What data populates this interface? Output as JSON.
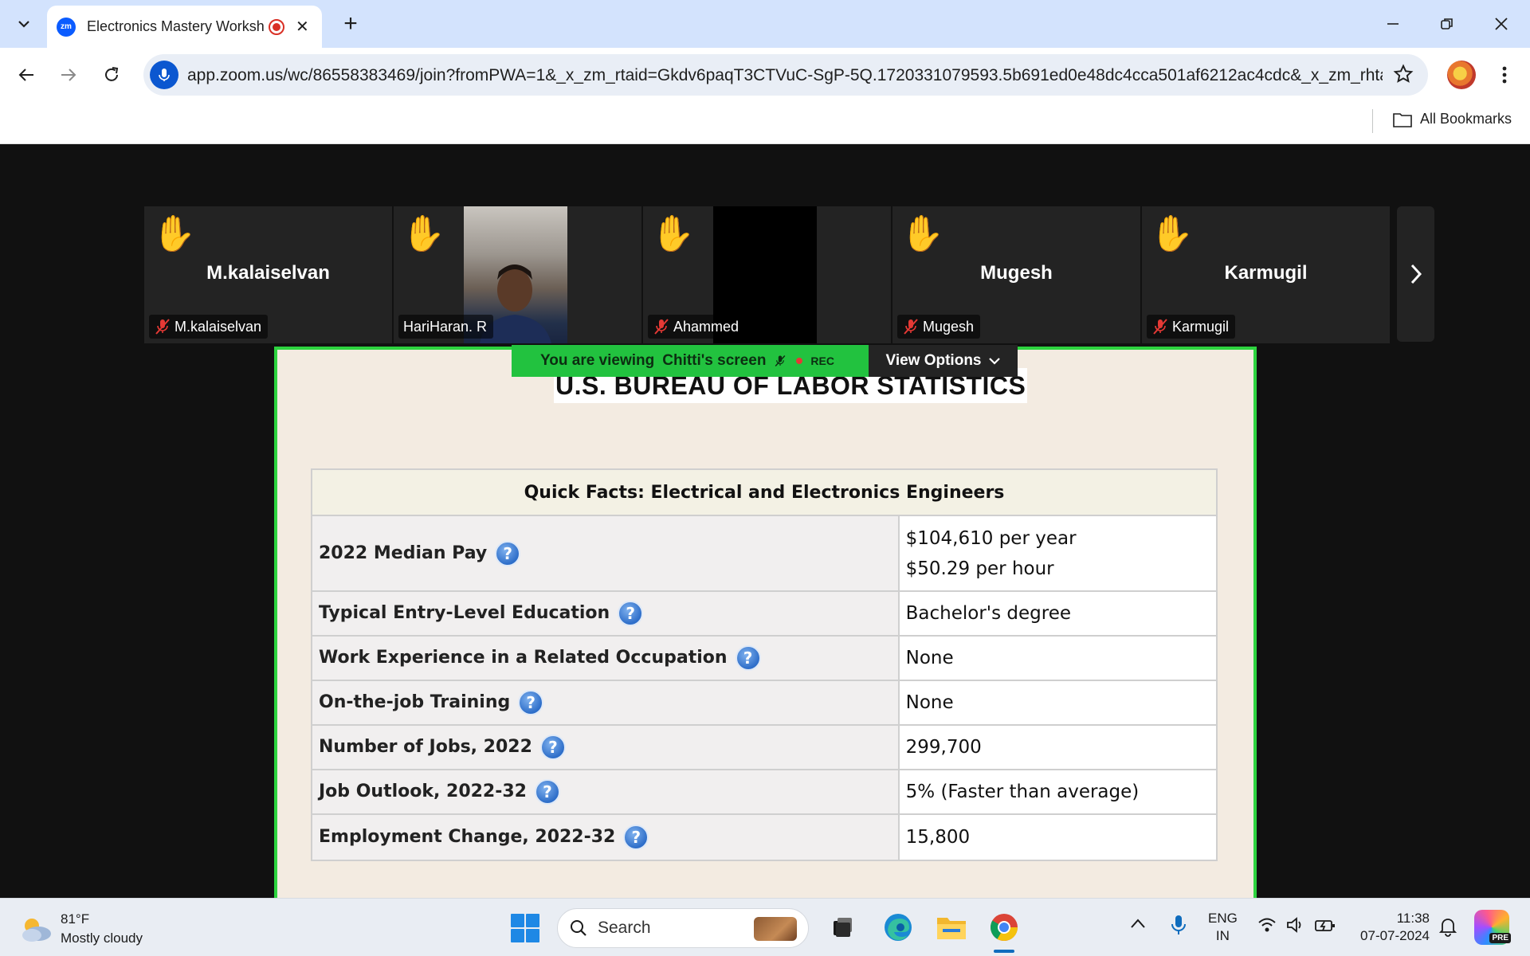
{
  "browser": {
    "tab_title": "Electronics Mastery Worksh",
    "tab_favicon": "zm",
    "url": "app.zoom.us/wc/86558383469/join?fromPWA=1&_x_zm_rtaid=Gkdv6paqT3CTVuC-SgP-5Q.1720331079593.5b691ed0e48dc4cca501af6212ac4cdc&_x_zm_rhtaid...",
    "bookmarks_label": "All Bookmarks"
  },
  "meeting": {
    "participants": [
      {
        "display": "M.kalaiselvan",
        "tag": "M.kalaiselvan",
        "muted": true,
        "video": false
      },
      {
        "display": "",
        "tag": "HariHaran. R",
        "muted": false,
        "video": true
      },
      {
        "display": "",
        "tag": "Ahammed",
        "muted": true,
        "video": true
      },
      {
        "display": "Mugesh",
        "tag": "Mugesh",
        "muted": true,
        "video": false
      },
      {
        "display": "Karmugil",
        "tag": "Karmugil",
        "muted": true,
        "video": false
      }
    ],
    "banner": {
      "prefix": "You are viewing",
      "screen_owner": "Chitti's screen",
      "rec": "REC"
    },
    "view_options": "View Options"
  },
  "slide": {
    "title": "U.S. BUREAU OF LABOR STATISTICS",
    "table_header": "Quick Facts: Electrical and Electronics Engineers",
    "rows": [
      {
        "label": "2022 Median Pay",
        "value": "$104,610 per year",
        "value2": "$50.29 per hour"
      },
      {
        "label": "Typical Entry-Level Education",
        "value": "Bachelor's degree"
      },
      {
        "label": "Work Experience in a Related Occupation",
        "value": "None"
      },
      {
        "label": "On-the-job Training",
        "value": "None"
      },
      {
        "label": "Number of Jobs, 2022",
        "value": "299,700"
      },
      {
        "label": "Job Outlook, 2022-32",
        "value": "5% (Faster than average)"
      },
      {
        "label": "Employment Change, 2022-32",
        "value": "15,800"
      }
    ],
    "help_glyph": "?"
  },
  "taskbar": {
    "weather_temp": "81°F",
    "weather_desc": "Mostly cloudy",
    "search_label": "Search",
    "lang_top": "ENG",
    "lang_bottom": "IN",
    "time": "11:38",
    "date": "07-07-2024",
    "copilot_badge": "PRE"
  },
  "colors": {
    "share_border": "#2dd43f",
    "banner_bg": "#22c23f",
    "tabstrip_bg": "#d3e3fd",
    "zoom_bg": "#111111"
  }
}
